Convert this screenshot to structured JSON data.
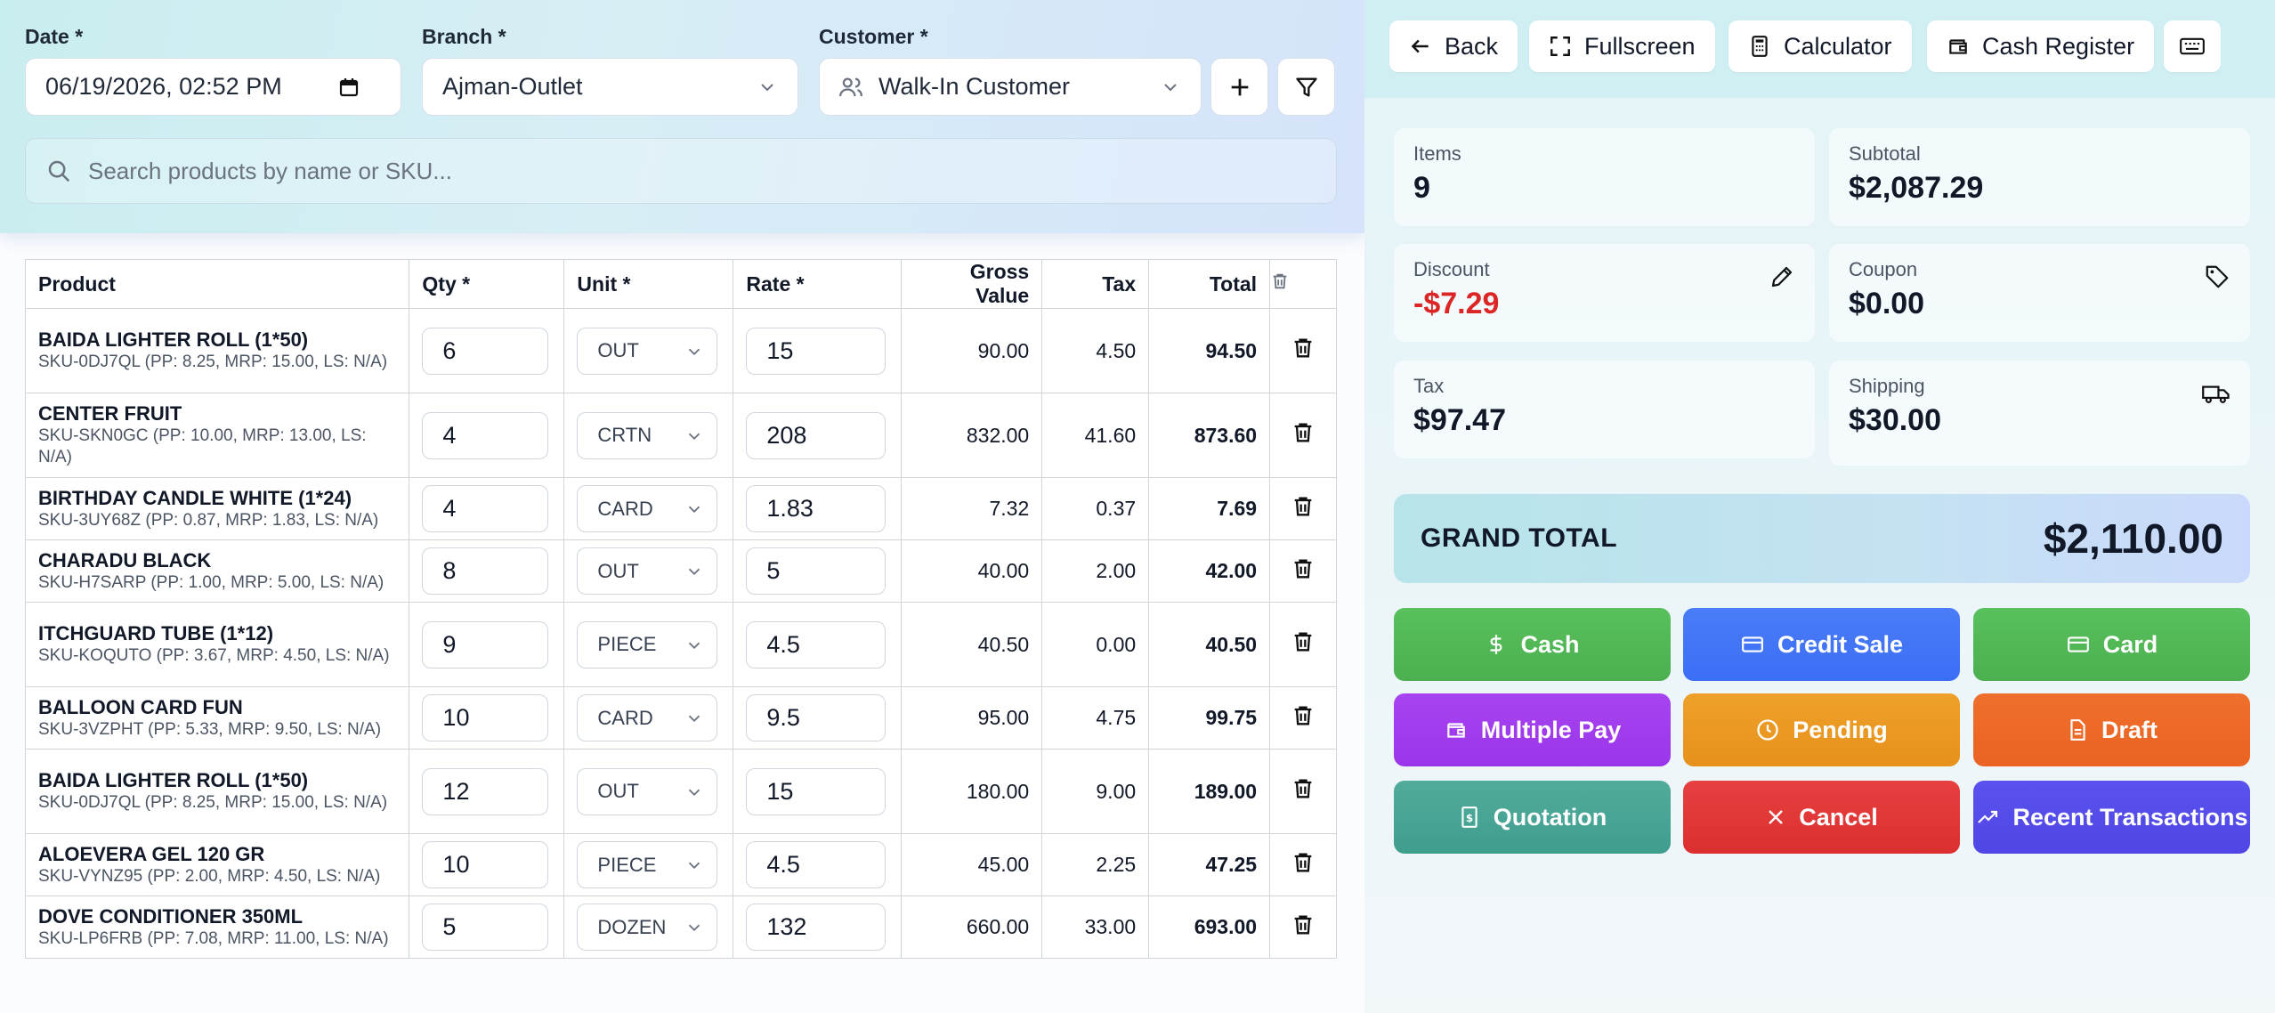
{
  "form": {
    "date_label": "Date *",
    "date_value": "06/19/2026, 02:52 PM",
    "branch_label": "Branch *",
    "branch_value": "Ajman-Outlet",
    "customer_label": "Customer *",
    "customer_value": "Walk-In Customer",
    "search_placeholder": "Search products by name or SKU..."
  },
  "table": {
    "headers": {
      "product": "Product",
      "qty": "Qty *",
      "unit": "Unit *",
      "rate": "Rate *",
      "gross": "Gross Value",
      "tax": "Tax",
      "total": "Total"
    },
    "rows": [
      {
        "name": "BAIDA LIGHTER ROLL (1*50)",
        "sku": "SKU-0DJ7QL (PP: 8.25, MRP: 15.00, LS: N/A)",
        "qty": "6",
        "unit": "OUT",
        "rate": "15",
        "gross": "90.00",
        "tax": "4.50",
        "total": "94.50"
      },
      {
        "name": "CENTER FRUIT",
        "sku": "SKU-SKN0GC (PP: 10.00, MRP: 13.00, LS: N/A)",
        "qty": "4",
        "unit": "CRTN",
        "rate": "208",
        "gross": "832.00",
        "tax": "41.60",
        "total": "873.60"
      },
      {
        "name": "BIRTHDAY CANDLE WHITE (1*24)",
        "sku": "SKU-3UY68Z (PP: 0.87, MRP: 1.83, LS: N/A)",
        "qty": "4",
        "unit": "CARD",
        "rate": "1.83",
        "gross": "7.32",
        "tax": "0.37",
        "total": "7.69"
      },
      {
        "name": "CHARADU BLACK",
        "sku": "SKU-H7SARP (PP: 1.00, MRP: 5.00, LS: N/A)",
        "qty": "8",
        "unit": "OUT",
        "rate": "5",
        "gross": "40.00",
        "tax": "2.00",
        "total": "42.00"
      },
      {
        "name": "ITCHGUARD TUBE (1*12)",
        "sku": "SKU-KOQUTO (PP: 3.67, MRP: 4.50, LS: N/A)",
        "qty": "9",
        "unit": "PIECE",
        "rate": "4.5",
        "gross": "40.50",
        "tax": "0.00",
        "total": "40.50"
      },
      {
        "name": "BALLOON CARD FUN",
        "sku": "SKU-3VZPHT (PP: 5.33, MRP: 9.50, LS: N/A)",
        "qty": "10",
        "unit": "CARD",
        "rate": "9.5",
        "gross": "95.00",
        "tax": "4.75",
        "total": "99.75"
      },
      {
        "name": "BAIDA LIGHTER ROLL (1*50)",
        "sku": "SKU-0DJ7QL (PP: 8.25, MRP: 15.00, LS: N/A)",
        "qty": "12",
        "unit": "OUT",
        "rate": "15",
        "gross": "180.00",
        "tax": "9.00",
        "total": "189.00"
      },
      {
        "name": "ALOEVERA GEL 120 GR",
        "sku": "SKU-VYNZ95 (PP: 2.00, MRP: 4.50, LS: N/A)",
        "qty": "10",
        "unit": "PIECE",
        "rate": "4.5",
        "gross": "45.00",
        "tax": "2.25",
        "total": "47.25"
      },
      {
        "name": "DOVE CONDITIONER 350ML",
        "sku": "SKU-LP6FRB (PP: 7.08, MRP: 11.00, LS: N/A)",
        "qty": "5",
        "unit": "DOZEN",
        "rate": "132",
        "gross": "660.00",
        "tax": "33.00",
        "total": "693.00"
      }
    ]
  },
  "toolbar": {
    "back": "Back",
    "fullscreen": "Fullscreen",
    "calculator": "Calculator",
    "cash_register": "Cash Register"
  },
  "summary": {
    "items_label": "Items",
    "items_value": "9",
    "subtotal_label": "Subtotal",
    "subtotal_value": "$2,087.29",
    "discount_label": "Discount",
    "discount_value": "-$7.29",
    "coupon_label": "Coupon",
    "coupon_value": "$0.00",
    "tax_label": "Tax",
    "tax_value": "$97.47",
    "shipping_label": "Shipping",
    "shipping_value": "$30.00",
    "grand_label": "GRAND TOTAL",
    "grand_value": "$2,110.00"
  },
  "payments": {
    "cash": "Cash",
    "credit_sale": "Credit Sale",
    "card": "Card",
    "multiple_pay": "Multiple Pay",
    "pending": "Pending",
    "draft": "Draft",
    "quotation": "Quotation",
    "cancel": "Cancel",
    "recent": "Recent Transactions"
  },
  "colors": {
    "cash": "#4caf50",
    "credit_sale": "#3b6ef5",
    "card": "#4caf50",
    "multiple_pay": "#9b35ea",
    "pending": "#e6911c",
    "draft": "#ea6322",
    "quotation": "#3f9e8e",
    "cancel": "#dc2f2f",
    "recent": "#4f46e5",
    "discount": "#dc2626"
  }
}
